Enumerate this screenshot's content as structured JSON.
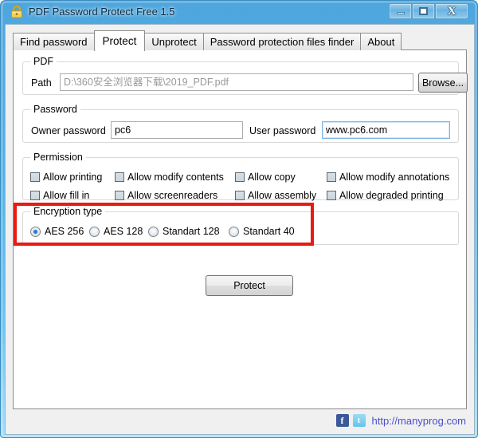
{
  "window": {
    "title": "PDF Password Protect Free 1.5",
    "icon": "padlock-icon",
    "controls": {
      "minimize": "minimize-icon",
      "maximize": "maximize-icon",
      "close": "X"
    }
  },
  "tabs": [
    {
      "label": "Find password",
      "active": false
    },
    {
      "label": "Protect",
      "active": true
    },
    {
      "label": "Unprotect",
      "active": false
    },
    {
      "label": "Password protection files finder",
      "active": false
    },
    {
      "label": "About",
      "active": false
    }
  ],
  "pdf_group": {
    "title": "PDF",
    "path_label": "Path",
    "path_value": "D:\\360安全浏览器下载\\2019_PDF.pdf",
    "browse_label": "Browse..."
  },
  "password_group": {
    "title": "Password",
    "owner_label": "Owner password",
    "owner_value": "pc6",
    "user_label": "User password",
    "user_value": "www.pc6.com"
  },
  "permission_group": {
    "title": "Permission",
    "items": [
      {
        "label": "Allow printing",
        "checked": false
      },
      {
        "label": "Allow modify contents",
        "checked": false
      },
      {
        "label": "Allow copy",
        "checked": false
      },
      {
        "label": "Allow modify annotations",
        "checked": false
      },
      {
        "label": "Allow fill in",
        "checked": false
      },
      {
        "label": "Allow screenreaders",
        "checked": false
      },
      {
        "label": "Allow assembly",
        "checked": false
      },
      {
        "label": "Allow degraded printing",
        "checked": false
      }
    ]
  },
  "encryption_group": {
    "title": "Encryption type",
    "options": [
      {
        "label": "AES 256",
        "selected": true
      },
      {
        "label": "AES 128",
        "selected": false
      },
      {
        "label": "Standart 128",
        "selected": false
      },
      {
        "label": "Standart 40",
        "selected": false
      }
    ]
  },
  "actions": {
    "protect_label": "Protect"
  },
  "highlight": {
    "color": "#e81b12"
  },
  "statusbar": {
    "facebook_icon": "f",
    "twitter_icon": "t",
    "site_url": "http://manyprog.com",
    "link_color": "#4b4ecb"
  }
}
